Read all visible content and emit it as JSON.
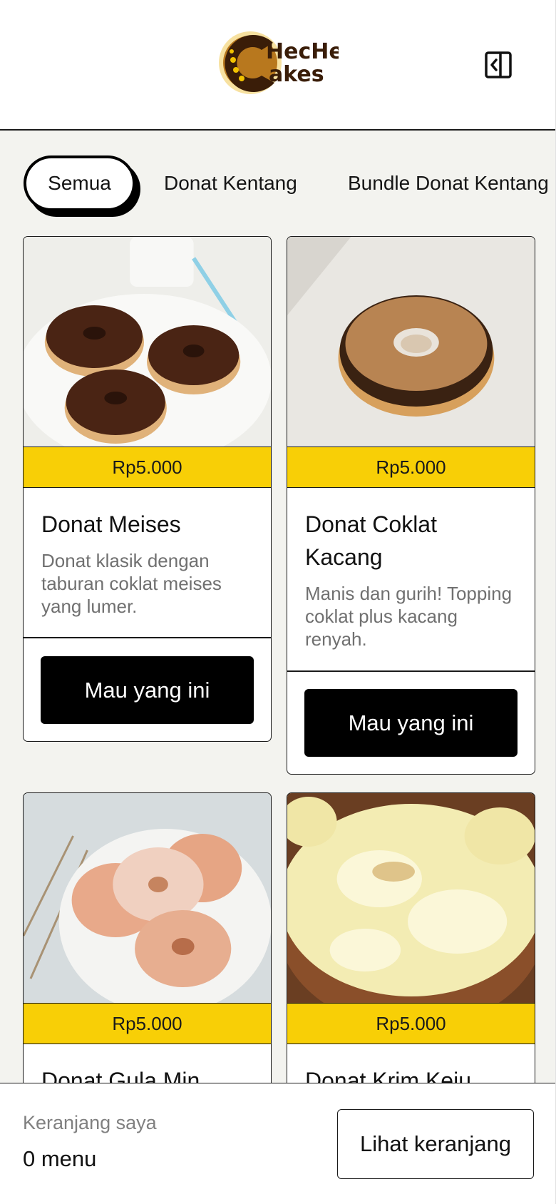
{
  "header": {
    "logo_text_line1": "HecHe",
    "logo_text_line2": "akes",
    "panel_icon": "sidebar-collapse-icon"
  },
  "tabs": [
    {
      "label": "Semua",
      "active": true
    },
    {
      "label": "Donat Kentang",
      "active": false
    },
    {
      "label": "Bundle Donat Kentang",
      "active": false
    }
  ],
  "products": [
    {
      "name": "Donat Meises",
      "price": "Rp5.000",
      "description": "Donat klasik dengan taburan coklat meises yang lumer.",
      "button_label": "Mau yang ini"
    },
    {
      "name": "Donat Coklat Kacang",
      "price": "Rp5.000",
      "description": "Manis dan gurih! Topping coklat plus kacang renyah.",
      "button_label": "Mau yang ini"
    },
    {
      "name": "Donat Gula Min",
      "price": "Rp5.000",
      "description": "",
      "button_label": ""
    },
    {
      "name": "Donat Krim Keju",
      "price": "Rp5.000",
      "description": "",
      "button_label": ""
    }
  ],
  "cart": {
    "label": "Keranjang saya",
    "count": "0 menu",
    "button_label": "Lihat keranjang"
  },
  "colors": {
    "accent_yellow": "#f8cf06",
    "content_bg": "#f3f3ef",
    "button_black": "#000000"
  }
}
